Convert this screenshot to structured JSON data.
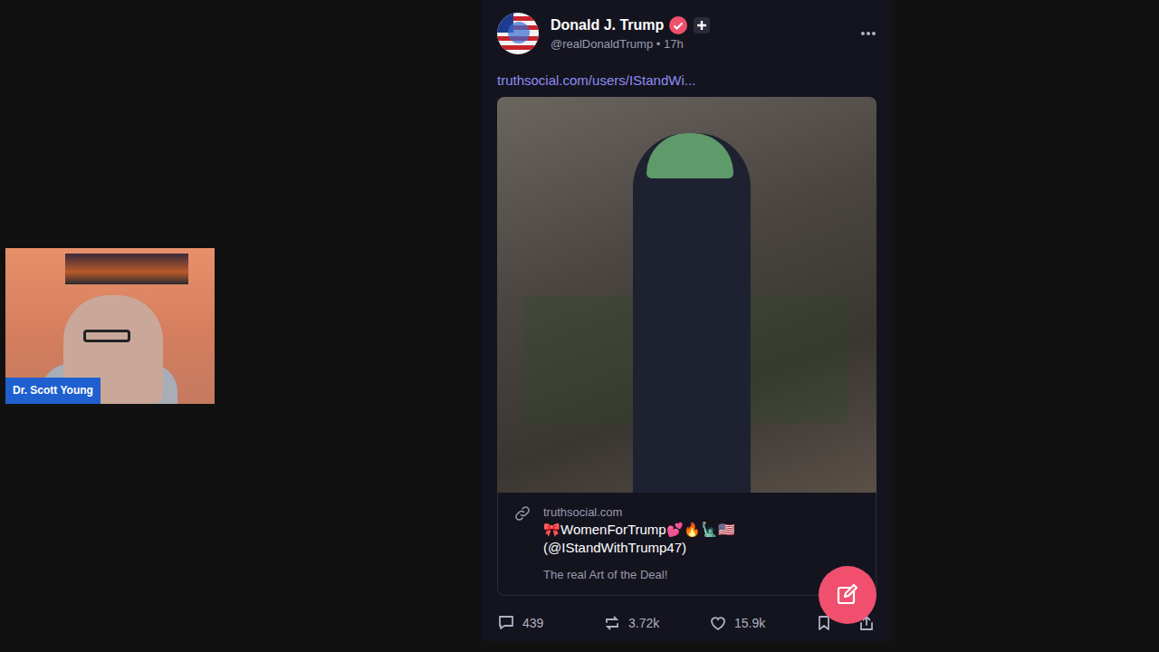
{
  "video_overlay": {
    "presenter_label": "Dr. Scott Young"
  },
  "post": {
    "author_name": "Donald J. Trump",
    "handle_time": "@realDonaldTrump • 17h",
    "link_text": "truthsocial.com/users/IStandWi...",
    "card": {
      "domain": "truthsocial.com",
      "title": "🎀WomenForTrump💕🔥🗽🇺🇸 (@IStandWithTrump47)",
      "description": "The real Art of the Deal!"
    },
    "actions": [
      {
        "name": "reply",
        "count": "439"
      },
      {
        "name": "repost",
        "count": "3.72k"
      },
      {
        "name": "like",
        "count": "15.9k"
      }
    ]
  }
}
